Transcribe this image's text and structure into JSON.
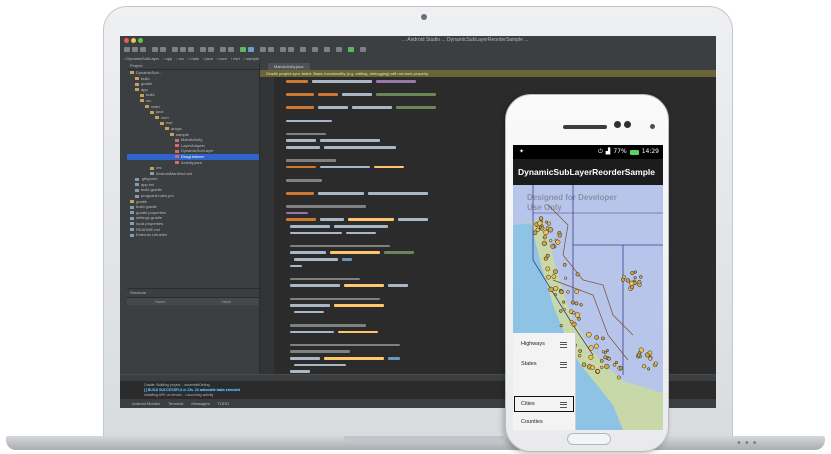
{
  "ide": {
    "window_title": "... Android Studio ... DynamicSubLayerReorderSample ...",
    "nav_crumbs": [
      "DynamicSubLayer",
      "app",
      "src",
      "main",
      "java",
      "com",
      "esri",
      "sample"
    ],
    "project_panel_title": "Project",
    "tree_items": [
      "DynamicSub...",
      "build",
      "gradle",
      "app",
      "build",
      "src",
      "main",
      "java",
      "com",
      "esri",
      "arcgis",
      "sample",
      "MainActivity",
      "LayerAdapter",
      "DynamicSubLayer",
      "DragListener",
      "Activity.java",
      "res",
      "AndroidManifest.xml",
      ".gitignore",
      "app.iml",
      "build.gradle",
      "proguard-rules.pro",
      "gradle",
      "build.gradle",
      "gradle.properties",
      "settings.gradle",
      "local.properties",
      "README.md",
      "External Libraries"
    ],
    "selected_tree_index": 15,
    "structure_title": "Structure",
    "structure_columns": [
      "Name",
      "Value"
    ],
    "editor_tab": "MainActivity.java",
    "warning_text": "Gradle project sync failed. Basic functionality (e.g. editing, debugging) will not work properly.",
    "run_lines": [
      "Gradle: Building project... assembleDebug",
      "[  ] BUILD SUCCESSFUL in 12s. 24 actionable tasks executed",
      "Installing APK on device... Launching activity"
    ],
    "status_tabs": [
      "Android Monitor",
      "Terminal",
      "Messages",
      "TODO"
    ]
  },
  "phone": {
    "status_time": "14:29",
    "status_battery": "77%",
    "app_title": "DynamicSubLayerReorderSample",
    "watermark": "Designed for Developer Use Only",
    "layers": [
      {
        "label": "Highways",
        "selected": false
      },
      {
        "label": "States",
        "selected": false
      },
      {
        "label": "",
        "selected": false
      },
      {
        "label": "Cities",
        "selected": true
      },
      {
        "label": "Counties",
        "selected": false
      }
    ]
  },
  "colors": {
    "ide_background": "#2b2b2b",
    "ide_panel": "#3c3f41",
    "selection": "#2f65ca",
    "map_states": "#b8c5ea",
    "map_land": "#c8d8a8",
    "map_ocean": "#8fc3e6"
  }
}
